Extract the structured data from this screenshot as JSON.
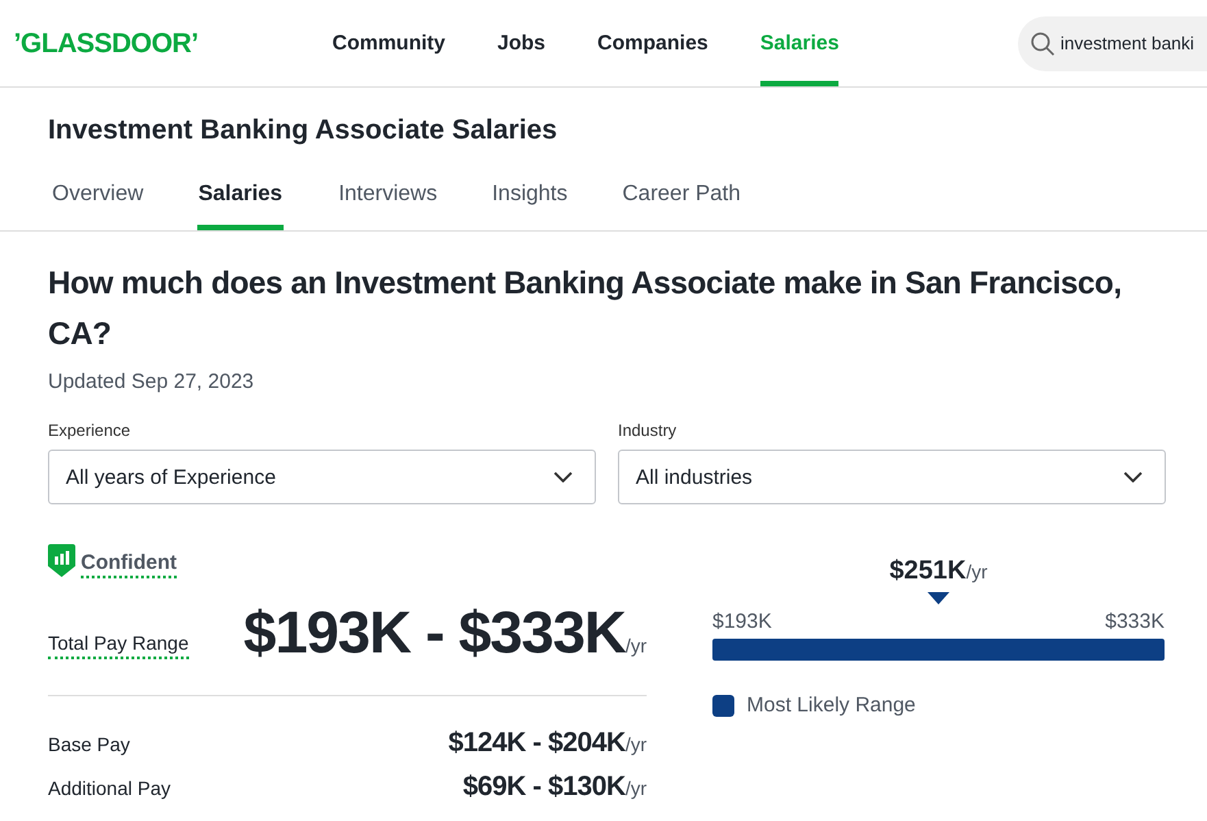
{
  "header": {
    "logo": "’GLASSDOOR’",
    "nav": [
      {
        "label": "Community",
        "selected": false
      },
      {
        "label": "Jobs",
        "selected": false
      },
      {
        "label": "Companies",
        "selected": false
      },
      {
        "label": "Salaries",
        "selected": true
      }
    ],
    "search": {
      "value": "investment banki"
    }
  },
  "job": {
    "title": "Investment Banking Associate Salaries",
    "tabs": [
      {
        "label": "Overview",
        "selected": false
      },
      {
        "label": "Salaries",
        "selected": true
      },
      {
        "label": "Interviews",
        "selected": false
      },
      {
        "label": "Insights",
        "selected": false
      },
      {
        "label": "Career Path",
        "selected": false
      }
    ]
  },
  "heading": "How much does an Investment Banking Associate make in San Francisco, CA?",
  "updated": "Updated Sep 27, 2023",
  "filters": [
    {
      "label": "Experience",
      "value": "All years of Experience"
    },
    {
      "label": "Industry",
      "value": "All industries"
    }
  ],
  "confidence": "Confident",
  "total": {
    "label": "Total Pay Range",
    "value": "$193K - $333K",
    "unit": "/yr"
  },
  "breakdown": [
    {
      "label": "Base Pay",
      "value": "$124K - $204K",
      "unit": "/yr"
    },
    {
      "label": "Additional Pay",
      "value": "$69K - $130K",
      "unit": "/yr"
    }
  ],
  "range": {
    "median": "$251K",
    "unit": "/yr",
    "low": "$193K",
    "high": "$333K",
    "legend": "Most Likely Range"
  }
}
